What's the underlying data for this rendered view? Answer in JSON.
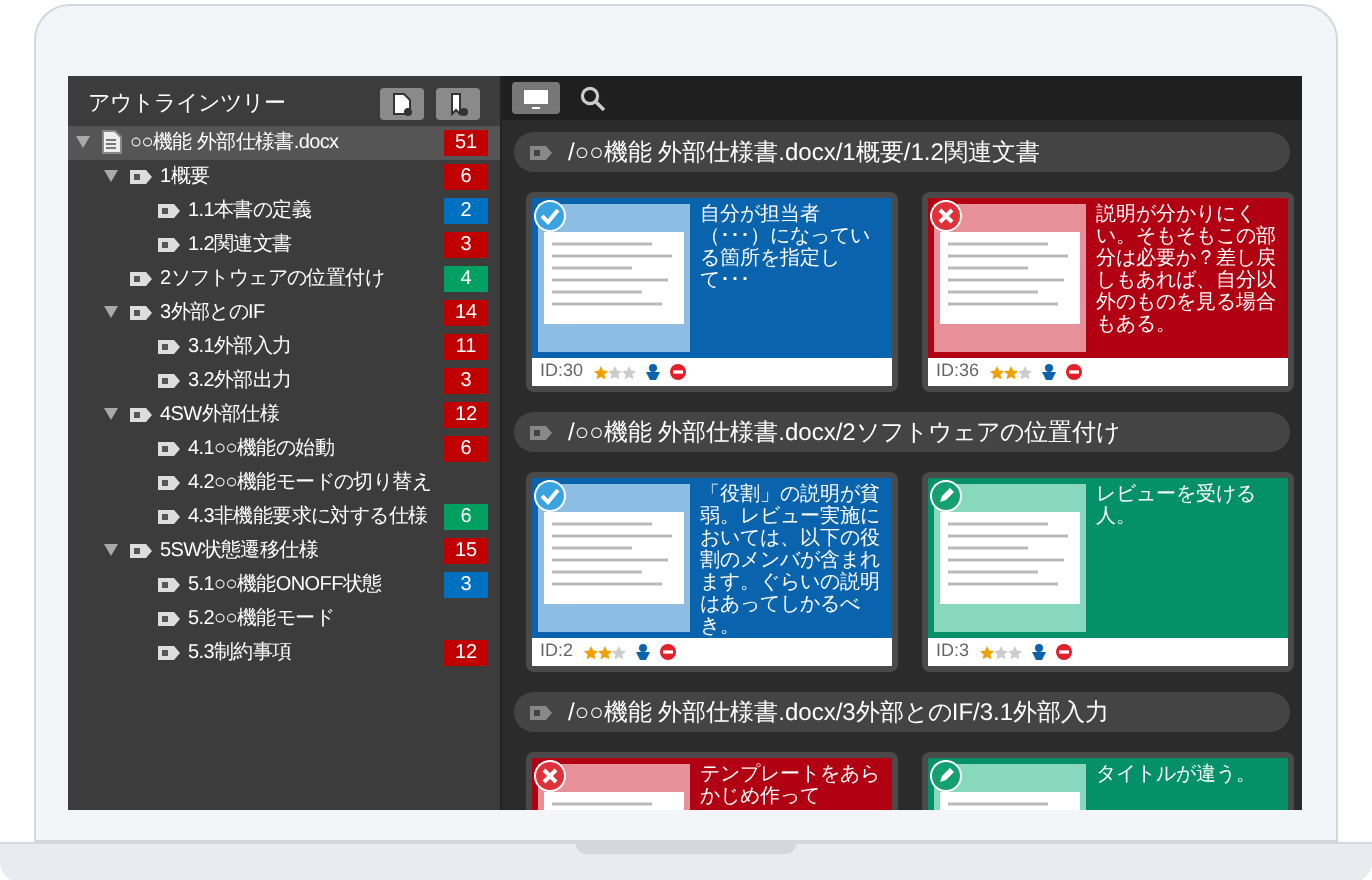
{
  "sidebar": {
    "title": "アウトラインツリー",
    "tree": [
      {
        "label": "○○機能 外部仕様書.docx",
        "kind": "document",
        "count": "51",
        "color": "#c00000",
        "expanded": true,
        "selected": true,
        "children": [
          {
            "label": "1概要",
            "kind": "section",
            "count": "6",
            "color": "#c00000",
            "expanded": true,
            "selected": false,
            "children": [
              {
                "label": "1.1本書の定義",
                "kind": "section",
                "count": "2",
                "color": "#0070c0",
                "selected": false
              },
              {
                "label": "1.2関連文書",
                "kind": "section",
                "count": "3",
                "color": "#c00000",
                "selected": false
              }
            ]
          },
          {
            "label": "2ソフトウェアの位置付け",
            "kind": "section",
            "count": "4",
            "color": "#00a060",
            "selected": false
          },
          {
            "label": "3外部とのIF",
            "kind": "section",
            "count": "14",
            "color": "#c00000",
            "expanded": true,
            "selected": false,
            "children": [
              {
                "label": "3.1外部入力",
                "kind": "section",
                "count": "11",
                "color": "#c00000",
                "selected": false
              },
              {
                "label": "3.2外部出力",
                "kind": "section",
                "count": "3",
                "color": "#c00000",
                "selected": false
              }
            ]
          },
          {
            "label": "4SW外部仕様",
            "kind": "section",
            "count": "12",
            "color": "#c00000",
            "expanded": true,
            "selected": false,
            "children": [
              {
                "label": "4.1○○機能の始動",
                "kind": "section",
                "count": "6",
                "color": "#c00000",
                "selected": false
              },
              {
                "label": "4.2○○機能モードの切り替え",
                "kind": "section",
                "selected": false
              },
              {
                "label": "4.3非機能要求に対する仕様",
                "kind": "section",
                "count": "6",
                "color": "#00a060",
                "selected": false
              }
            ]
          },
          {
            "label": "5SW状態遷移仕様",
            "kind": "section",
            "count": "15",
            "color": "#c00000",
            "expanded": true,
            "selected": false,
            "children": [
              {
                "label": "5.1○○機能ONOFF状態",
                "kind": "section",
                "count": "3",
                "color": "#0070c0",
                "selected": false
              },
              {
                "label": "5.2○○機能モード",
                "kind": "section",
                "selected": false
              },
              {
                "label": "5.3制約事項",
                "kind": "section",
                "count": "12",
                "color": "#c00000",
                "selected": false
              }
            ]
          }
        ]
      }
    ]
  },
  "groups": [
    {
      "path": "/○○機能 外部仕様書.docx/1概要/1.2関連文書",
      "cards": [
        {
          "kind": "approved",
          "comment": "自分が担当者（･･･）になっている箇所を指定して･･･",
          "id": "ID:30",
          "stars": 1
        },
        {
          "kind": "rejected",
          "comment": "説明が分かりにくい。そもそもこの部分は必要か？差し戻しもあれば、自分以外のものを見る場合もある。",
          "id": "ID:36",
          "stars": 2
        }
      ]
    },
    {
      "path": "/○○機能 外部仕様書.docx/2ソフトウェアの位置付け",
      "cards": [
        {
          "kind": "approved",
          "comment": "「役割」の説明が貧弱。レビュー実施においては、以下の役割のメンバが含まれます。ぐらいの説明はあってしかるべき。",
          "id": "ID:2",
          "stars": 2
        },
        {
          "kind": "comment",
          "comment": "レビューを受ける人。",
          "id": "ID:3",
          "stars": 1
        }
      ]
    },
    {
      "path": "/○○機能 外部仕様書.docx/3外部とのIF/3.1外部入力",
      "cards": [
        {
          "kind": "rejected",
          "comment": "テンプレートをあらかじめ作って"
        },
        {
          "kind": "comment",
          "comment": "タイトルが違う。"
        }
      ]
    }
  ]
}
